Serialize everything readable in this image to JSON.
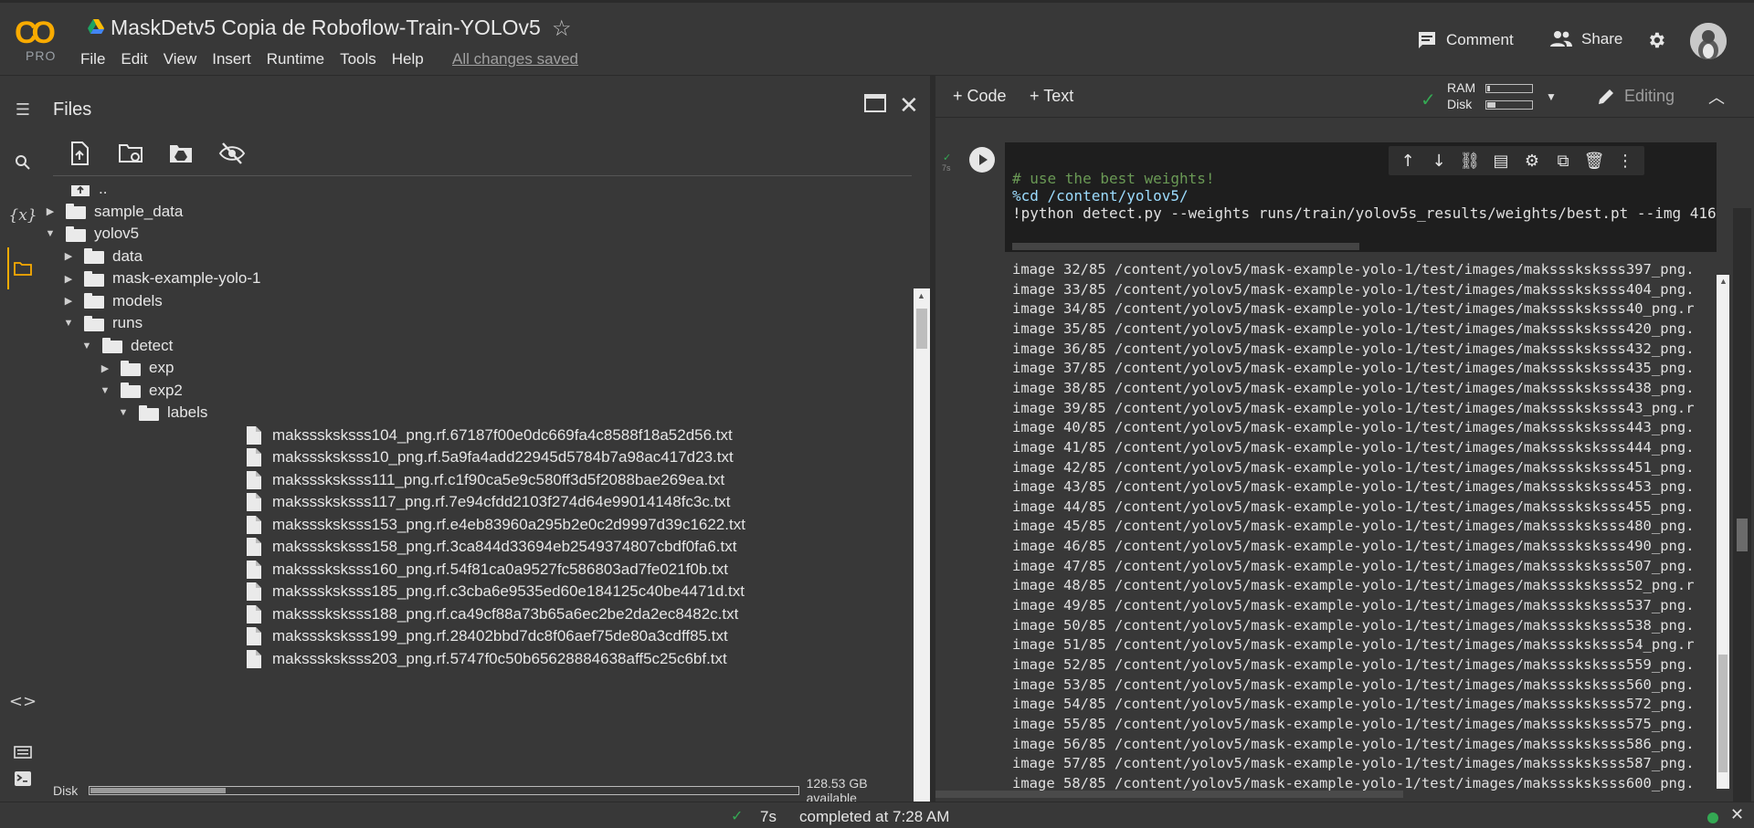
{
  "app": {
    "logo_text": "CO",
    "logo_sub": "PRO",
    "title": "MaskDetv5 Copia de Roboflow-Train-YOLOv5",
    "save_status": "All changes saved"
  },
  "menu": [
    "File",
    "Edit",
    "View",
    "Insert",
    "Runtime",
    "Tools",
    "Help"
  ],
  "header_actions": {
    "comment": "Comment",
    "share": "Share"
  },
  "files_panel": {
    "title": "Files",
    "disk_label": "Disk",
    "disk_available": "128.53 GB available",
    "disk_used_fraction": 0.19
  },
  "tree": [
    {
      "depth": 0,
      "type": "up",
      "label": ".."
    },
    {
      "depth": 0,
      "type": "folder",
      "caret": "right",
      "label": "sample_data"
    },
    {
      "depth": 0,
      "type": "folder",
      "caret": "down",
      "label": "yolov5"
    },
    {
      "depth": 1,
      "type": "folder",
      "caret": "right",
      "label": "data"
    },
    {
      "depth": 1,
      "type": "folder",
      "caret": "right",
      "label": "mask-example-yolo-1"
    },
    {
      "depth": 1,
      "type": "folder",
      "caret": "right",
      "label": "models"
    },
    {
      "depth": 1,
      "type": "folder",
      "caret": "down",
      "label": "runs"
    },
    {
      "depth": 2,
      "type": "folder",
      "caret": "down",
      "label": "detect"
    },
    {
      "depth": 3,
      "type": "folder",
      "caret": "right",
      "label": "exp"
    },
    {
      "depth": 3,
      "type": "folder",
      "caret": "down",
      "label": "exp2"
    },
    {
      "depth": 4,
      "type": "folder",
      "caret": "down",
      "label": "labels"
    },
    {
      "depth": 5,
      "type": "file",
      "label": "maksssksksss104_png.rf.67187f00e0dc669fa4c8588f18a52d56.txt"
    },
    {
      "depth": 5,
      "type": "file",
      "label": "maksssksksss10_png.rf.5a9fa4add22945d5784b7a98ac417d23.txt"
    },
    {
      "depth": 5,
      "type": "file",
      "label": "maksssksksss111_png.rf.c1f90ca5e9c580ff3d5f2088bae269ea.txt"
    },
    {
      "depth": 5,
      "type": "file",
      "label": "maksssksksss117_png.rf.7e94cfdd2103f274d64e99014148fc3c.txt"
    },
    {
      "depth": 5,
      "type": "file",
      "label": "maksssksksss153_png.rf.e4eb83960a295b2e0c2d9997d39c1622.txt"
    },
    {
      "depth": 5,
      "type": "file",
      "label": "maksssksksss158_png.rf.3ca844d33694eb2549374807cbdf0fa6.txt"
    },
    {
      "depth": 5,
      "type": "file",
      "label": "maksssksksss160_png.rf.54f81ca0a9527fc586803ad7fe021f0b.txt"
    },
    {
      "depth": 5,
      "type": "file",
      "label": "maksssksksss185_png.rf.c3cba6e9535ed60e184125c40be4471d.txt"
    },
    {
      "depth": 5,
      "type": "file",
      "label": "maksssksksss188_png.rf.ca49cf88a73b65a6ec2be2da2ec8482c.txt"
    },
    {
      "depth": 5,
      "type": "file",
      "label": "maksssksksss199_png.rf.28402bbd7dc8f06aef75de80a3cdff85.txt"
    },
    {
      "depth": 5,
      "type": "file",
      "label": "maksssksksss203_png.rf.5747f0c50b65628884638aff5c25c6bf.txt"
    }
  ],
  "notebook": {
    "add_code": "Code",
    "add_text": "Text",
    "ram_label": "RAM",
    "disk_label": "Disk",
    "ram_fraction": 0.06,
    "disk_fraction": 0.19,
    "editing": "Editing"
  },
  "cell": {
    "exec_time": "7s",
    "code": [
      {
        "text": "# use the best weights!",
        "color": "#6a9955"
      },
      {
        "text": "%cd /content/yolov5/",
        "color": "#9cdcfe"
      },
      {
        "text": "!python detect.py --weights runs/train/yolov5s_results/weights/best.pt --img 416",
        "color": "#e0e0e0"
      }
    ],
    "output": [
      "image 32/85 /content/yolov5/mask-example-yolo-1/test/images/maksssksksss397_png.",
      "image 33/85 /content/yolov5/mask-example-yolo-1/test/images/maksssksksss404_png.",
      "image 34/85 /content/yolov5/mask-example-yolo-1/test/images/maksssksksss40_png.r",
      "image 35/85 /content/yolov5/mask-example-yolo-1/test/images/maksssksksss420_png.",
      "image 36/85 /content/yolov5/mask-example-yolo-1/test/images/maksssksksss432_png.",
      "image 37/85 /content/yolov5/mask-example-yolo-1/test/images/maksssksksss435_png.",
      "image 38/85 /content/yolov5/mask-example-yolo-1/test/images/maksssksksss438_png.",
      "image 39/85 /content/yolov5/mask-example-yolo-1/test/images/maksssksksss43_png.r",
      "image 40/85 /content/yolov5/mask-example-yolo-1/test/images/maksssksksss443_png.",
      "image 41/85 /content/yolov5/mask-example-yolo-1/test/images/maksssksksss444_png.",
      "image 42/85 /content/yolov5/mask-example-yolo-1/test/images/maksssksksss451_png.",
      "image 43/85 /content/yolov5/mask-example-yolo-1/test/images/maksssksksss453_png.",
      "image 44/85 /content/yolov5/mask-example-yolo-1/test/images/maksssksksss455_png.",
      "image 45/85 /content/yolov5/mask-example-yolo-1/test/images/maksssksksss480_png.",
      "image 46/85 /content/yolov5/mask-example-yolo-1/test/images/maksssksksss490_png.",
      "image 47/85 /content/yolov5/mask-example-yolo-1/test/images/maksssksksss507_png.",
      "image 48/85 /content/yolov5/mask-example-yolo-1/test/images/maksssksksss52_png.r",
      "image 49/85 /content/yolov5/mask-example-yolo-1/test/images/maksssksksss537_png.",
      "image 50/85 /content/yolov5/mask-example-yolo-1/test/images/maksssksksss538_png.",
      "image 51/85 /content/yolov5/mask-example-yolo-1/test/images/maksssksksss54_png.r",
      "image 52/85 /content/yolov5/mask-example-yolo-1/test/images/maksssksksss559_png.",
      "image 53/85 /content/yolov5/mask-example-yolo-1/test/images/maksssksksss560_png.",
      "image 54/85 /content/yolov5/mask-example-yolo-1/test/images/maksssksksss572_png.",
      "image 55/85 /content/yolov5/mask-example-yolo-1/test/images/maksssksksss575_png.",
      "image 56/85 /content/yolov5/mask-example-yolo-1/test/images/maksssksksss586_png.",
      "image 57/85 /content/yolov5/mask-example-yolo-1/test/images/maksssksksss587_png.",
      "image 58/85 /content/yolov5/mask-example-yolo-1/test/images/maksssksksss600_png."
    ]
  },
  "status": {
    "time": "7s",
    "message": "completed at 7:28 AM"
  },
  "colors": {
    "accent": "#f9ab00",
    "ok": "#34a853",
    "background": "#383838"
  }
}
